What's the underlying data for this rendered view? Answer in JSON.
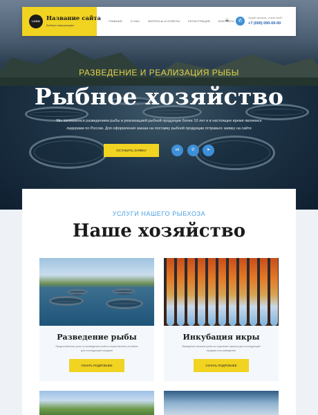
{
  "header": {
    "logo_text": "LOGO",
    "site_name": "Название сайта",
    "site_tagline": "Выбери информацию",
    "menu": [
      "Главная",
      "О нас",
      "Вопросы и ответы",
      "Регистрация",
      "Контакты"
    ],
    "call_note": "Задай звонком, отзыв свой?",
    "phone": "+7 (000) 000-00-00"
  },
  "hero": {
    "subtitle": "РАЗВЕДЕНИЕ И РЕАЛИЗАЦИЯ РЫБЫ",
    "title": "Рыбное хозяйство",
    "text": "Мы занимаемся разведением рыбы и реализацией рыбной продукции более 10 лет и в настоящее время являемся лидерами по России. Для оформления заказа на поставку рыбной продукции отправьте заявку на сайте",
    "cta_label": "Оставить заявку",
    "social": [
      "vk-icon",
      "viber-icon",
      "telegram-icon"
    ]
  },
  "services": {
    "kicker": "УСЛУГИ НАШЕГО РЫБХОЗА",
    "title": "Наше хозяйство",
    "cards": [
      {
        "title": "Разведение рыбы",
        "text": "Предоставление услуг по разведению рыбы в искусственных условиях для последующей продажи",
        "button": "Узнать подробнее"
      },
      {
        "title": "Инкубация икры",
        "text": "Выведение мальков рыбы из отдельных икринок для последующей продажи или разведения",
        "button": "Узнать подробнее"
      }
    ]
  },
  "colors": {
    "accent_yellow": "#f1d322",
    "accent_blue": "#3d8fd6",
    "kicker_blue": "#4a9fe0",
    "hero_gold": "#e4d64a"
  }
}
